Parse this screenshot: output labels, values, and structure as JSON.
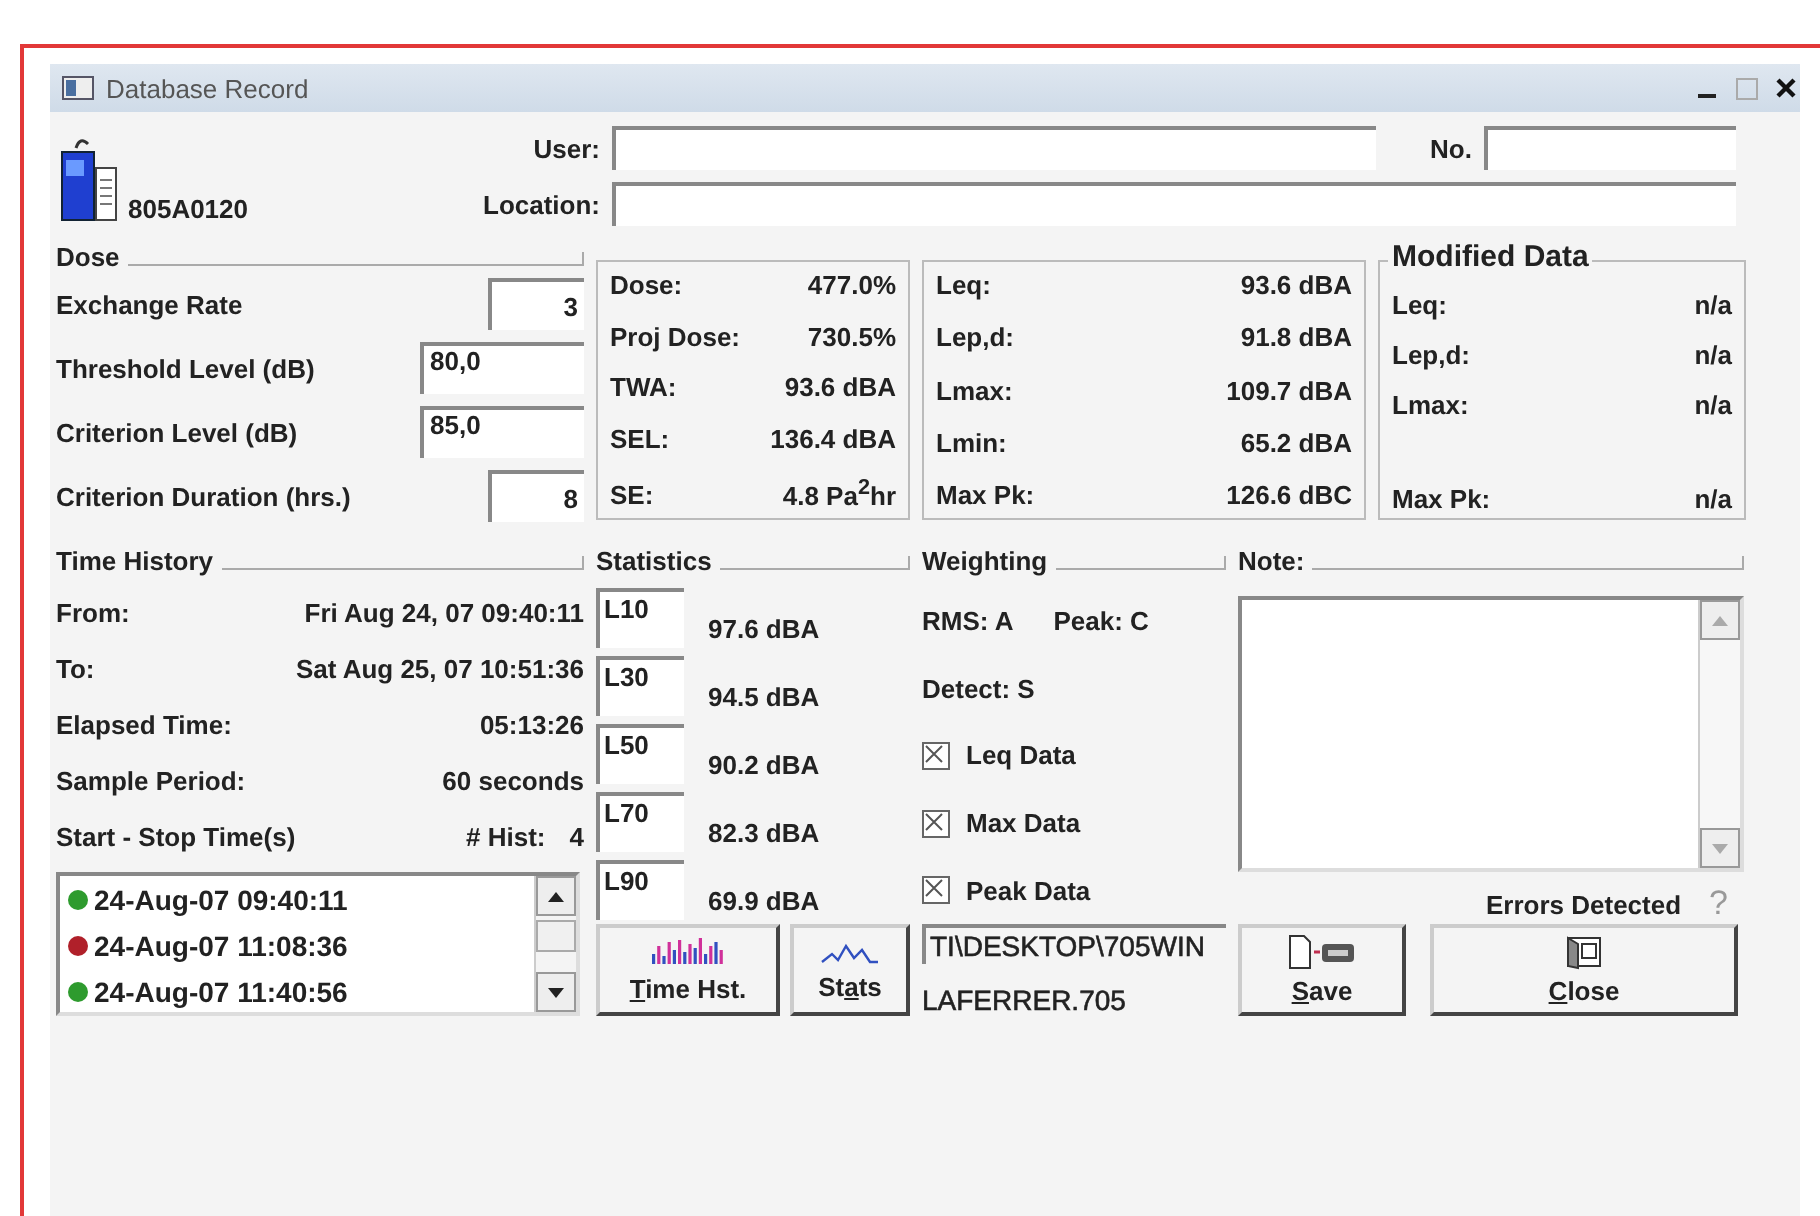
{
  "window": {
    "title": "Database Record"
  },
  "header": {
    "serial": "805A0120",
    "user": {
      "label": "User:"
    },
    "number": {
      "label": "No."
    },
    "location": {
      "label": "Location:"
    }
  },
  "dose": {
    "title": "Dose",
    "fields": [
      {
        "label": "Exchange Rate",
        "value": "3",
        "kind": "integer"
      },
      {
        "label": "Threshold Level (dB)",
        "value": "80,0",
        "kind": "decimal"
      },
      {
        "label": "Criterion Level (dB)",
        "value": "85,0",
        "kind": "decimal"
      },
      {
        "label": "Criterion Duration (hrs.)",
        "value": "8",
        "kind": "integer"
      }
    ]
  },
  "dose_results": [
    {
      "label": "Dose:",
      "value": "477.0%"
    },
    {
      "label": "Proj Dose:",
      "value": "730.5%"
    },
    {
      "label": "TWA:",
      "value": "93.6 dBA"
    },
    {
      "label": "SEL:",
      "value": "136.4 dBA"
    },
    {
      "label": "SE:",
      "value": "4.8 Pa$^{2}$hr"
    }
  ],
  "levels": [
    {
      "label": "Leq:",
      "value": "93.6 dBA"
    },
    {
      "label": "Lep,d:",
      "value": "91.8 dBA"
    },
    {
      "label": "Lmax:",
      "value": "109.7 dBA"
    },
    {
      "label": "Lmin:",
      "value": "65.2 dBA"
    },
    {
      "label": "Max Pk:",
      "value": "126.6 dBC"
    }
  ],
  "modified_data": {
    "title": "Modified Data",
    "rows": [
      {
        "label": "Leq:",
        "value": "n/a"
      },
      {
        "label": "Lep,d:",
        "value": "n/a"
      },
      {
        "label": "Lmax:",
        "value": "n/a"
      },
      {
        "label": "Max Pk:",
        "value": "n/a",
        "gap_before": true
      }
    ]
  },
  "time_history": {
    "title": "Time History",
    "rows": [
      {
        "label": "From:",
        "value": "Fri Aug 24, 07 09:40:11"
      },
      {
        "label": "To:",
        "value": "Sat Aug 25, 07 10:51:36"
      },
      {
        "label": "Elapsed Time:",
        "value": "05:13:26"
      },
      {
        "label": "Sample Period:",
        "value": "60 seconds"
      }
    ],
    "start_stop_label": "Start - Stop Time(s)",
    "hist_label": "# Hist:",
    "hist_count": "4",
    "entries": [
      {
        "time": "24-Aug-07 09:40:11",
        "color": "#2e9b2e"
      },
      {
        "time": "24-Aug-07 11:08:36",
        "color": "#b0202a"
      },
      {
        "time": "24-Aug-07 11:40:56",
        "color": "#2e9b2e"
      }
    ]
  },
  "statistics": {
    "title": "Statistics",
    "rows": [
      {
        "label": "L10",
        "value": "97.6 dBA"
      },
      {
        "label": "L30",
        "value": "94.5 dBA"
      },
      {
        "label": "L50",
        "value": "90.2 dBA"
      },
      {
        "label": "L70",
        "value": "82.3 dBA"
      },
      {
        "label": "L90",
        "value": "69.9 dBA"
      }
    ]
  },
  "weighting": {
    "title": "Weighting",
    "rms": "RMS: A",
    "peak": "Peak: C",
    "detect": "Detect: S",
    "checks": [
      {
        "label": "Leq Data",
        "checked": true
      },
      {
        "label": "Max Data",
        "checked": true
      },
      {
        "label": "Peak Data",
        "checked": true
      }
    ]
  },
  "note": {
    "label": "Note:"
  },
  "errors": {
    "label": "Errors Detected",
    "help": "?"
  },
  "file_path": [
    "TI\\DESKTOP\\705WIN",
    "LAFERRER.705"
  ],
  "buttons": [
    {
      "underlined": "T",
      "after": "ime Hst.",
      "kind": "history"
    },
    {
      "before": "St",
      "underlined": "a",
      "after": "ts",
      "kind": "stats"
    },
    {
      "underlined": "S",
      "after": "ave",
      "kind": "save"
    },
    {
      "underlined": "C",
      "after": "lose",
      "kind": "close"
    }
  ]
}
